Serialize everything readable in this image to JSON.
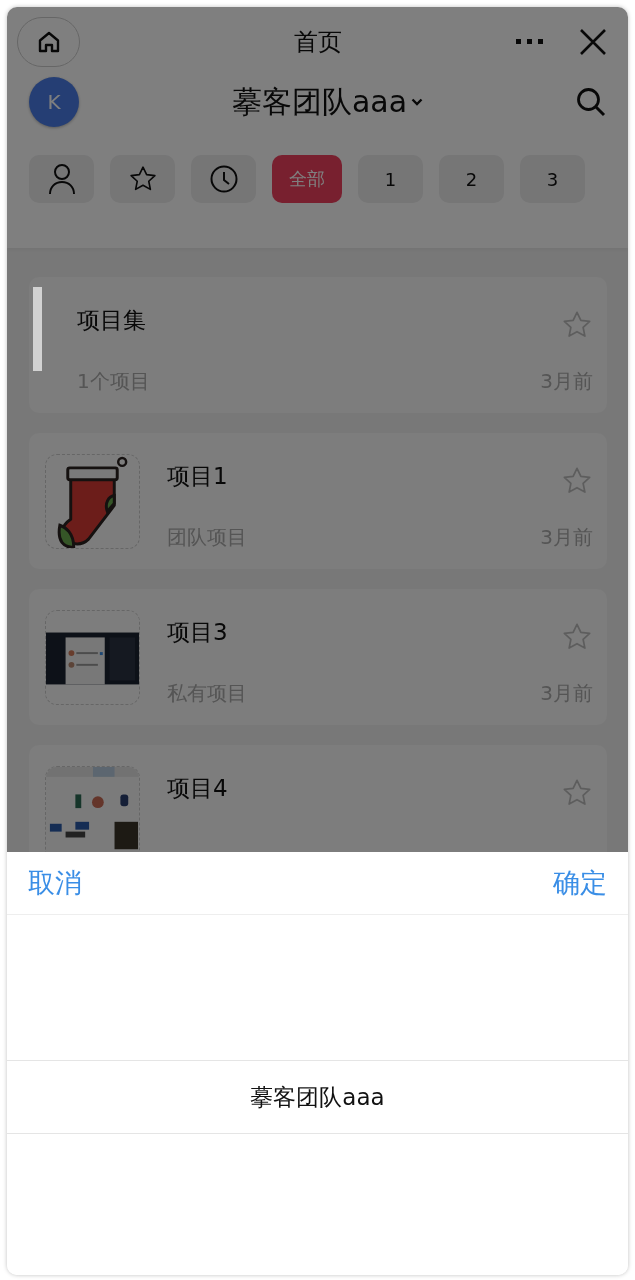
{
  "top_bar": {
    "title": "首页"
  },
  "team_bar": {
    "avatar": "K",
    "team_name": "摹客团队aaa"
  },
  "filters": [
    {
      "kind": "person",
      "selected": false
    },
    {
      "kind": "star",
      "selected": false
    },
    {
      "kind": "clock",
      "selected": false
    },
    {
      "kind": "label",
      "label": "全部",
      "selected": true
    },
    {
      "kind": "label",
      "label": "1",
      "selected": false
    },
    {
      "kind": "label",
      "label": "2",
      "selected": false
    },
    {
      "kind": "label",
      "label": "3",
      "selected": false
    }
  ],
  "cards": [
    {
      "kind": "collection",
      "title": "项目集",
      "subtitle": "1个项目",
      "time": "3月前",
      "favorite": false
    },
    {
      "kind": "project",
      "title": "项目1",
      "subtitle": "团队项目",
      "time": "3月前",
      "favorite": false
    },
    {
      "kind": "project",
      "title": "项目3",
      "subtitle": "私有项目",
      "time": "3月前",
      "favorite": false
    },
    {
      "kind": "project",
      "title": "项目4",
      "favorite": false
    }
  ],
  "picker": {
    "cancel": "取消",
    "confirm": "确定",
    "options": [
      {
        "label": "摹客团队aaa",
        "selected": true
      }
    ]
  }
}
